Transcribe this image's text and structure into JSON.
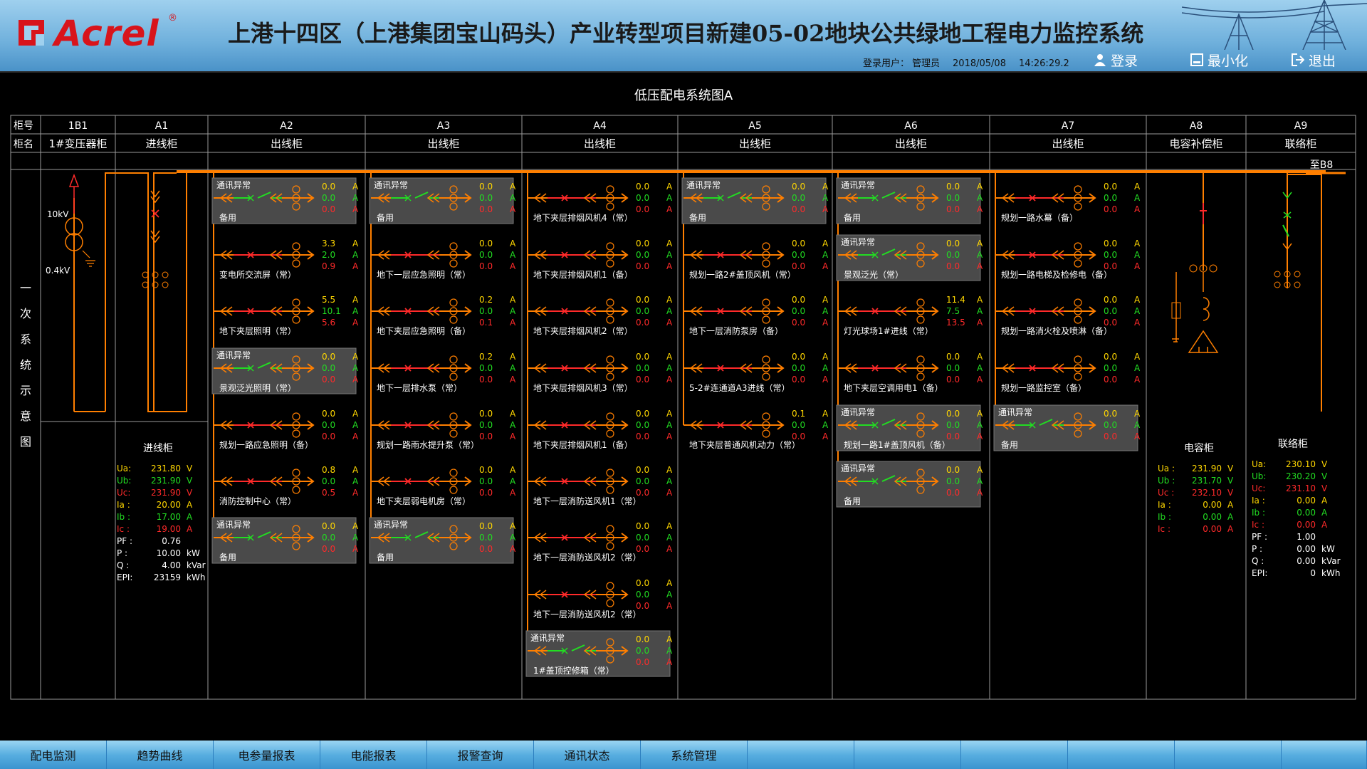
{
  "header": {
    "logo_text": "Acrel",
    "logo_reg": "®",
    "title": "上港十四区（上港集团宝山码头）产业转型项目新建05-02地块公共绿地工程电力监控系统",
    "user_label": "登录用户：",
    "user_name": "管理员",
    "date": "2018/05/08",
    "time": "14:26:29.2",
    "login_label": "登录",
    "minimize_label": "最小化",
    "exit_label": "退出"
  },
  "diagram_title": "低压配电系统图A",
  "row_labels": {
    "cabinet_no": "柜号",
    "cabinet_name": "柜名"
  },
  "side_label": [
    "一",
    "次",
    "系",
    "统",
    "示",
    "意",
    "图"
  ],
  "bus_to": "至B8",
  "cabinets": [
    {
      "no": "1B1",
      "name": "1#变压器柜"
    },
    {
      "no": "A1",
      "name": "进线柜"
    },
    {
      "no": "A2",
      "name": "出线柜"
    },
    {
      "no": "A3",
      "name": "出线柜"
    },
    {
      "no": "A4",
      "name": "出线柜"
    },
    {
      "no": "A5",
      "name": "出线柜"
    },
    {
      "no": "A6",
      "name": "出线柜"
    },
    {
      "no": "A7",
      "name": "出线柜"
    },
    {
      "no": "A8",
      "name": "电容补偿柜"
    },
    {
      "no": "A9",
      "name": "联络柜"
    }
  ],
  "transformer": {
    "hv": "10kV",
    "lv": "0.4kV"
  },
  "comm_error": "通讯异常",
  "unit_a": "A",
  "feeders": [
    [
      {
        "name": "备用",
        "err": true,
        "ia": "0.0",
        "ib": "0.0",
        "ic": "0.0"
      },
      {
        "name": "变电所交流屏（常）",
        "err": false,
        "ia": "3.3",
        "ib": "2.0",
        "ic": "0.9"
      },
      {
        "name": "地下夹层照明（常）",
        "err": false,
        "ia": "5.5",
        "ib": "10.1",
        "ic": "5.6"
      },
      {
        "name": "景观泛光照明（常）",
        "err": true,
        "ia": "0.0",
        "ib": "0.0",
        "ic": "0.0"
      },
      {
        "name": "规划一路应急照明（备）",
        "err": false,
        "ia": "0.0",
        "ib": "0.0",
        "ic": "0.0"
      },
      {
        "name": "消防控制中心（常）",
        "err": false,
        "ia": "0.8",
        "ib": "0.0",
        "ic": "0.5"
      },
      {
        "name": "备用",
        "err": true,
        "ia": "0.0",
        "ib": "0.0",
        "ic": "0.0"
      }
    ],
    [
      {
        "name": "备用",
        "err": true,
        "ia": "0.0",
        "ib": "0.0",
        "ic": "0.0"
      },
      {
        "name": "地下一层应急照明（常）",
        "err": false,
        "ia": "0.0",
        "ib": "0.0",
        "ic": "0.0"
      },
      {
        "name": "地下夹层应急照明（备）",
        "err": false,
        "ia": "0.2",
        "ib": "0.0",
        "ic": "0.1"
      },
      {
        "name": "地下一层排水泵（常）",
        "err": false,
        "ia": "0.2",
        "ib": "0.0",
        "ic": "0.0"
      },
      {
        "name": "规划一路雨水提升泵（常）",
        "err": false,
        "ia": "0.0",
        "ib": "0.0",
        "ic": "0.0"
      },
      {
        "name": "地下夹层弱电机房（常）",
        "err": false,
        "ia": "0.0",
        "ib": "0.0",
        "ic": "0.0"
      },
      {
        "name": "备用",
        "err": true,
        "ia": "0.0",
        "ib": "0.0",
        "ic": "0.0"
      }
    ],
    [
      {
        "name": "地下夹层排烟风机4（常）",
        "err": false,
        "ia": "0.0",
        "ib": "0.0",
        "ic": "0.0"
      },
      {
        "name": "地下夹层排烟风机1（备）",
        "err": false,
        "ia": "0.0",
        "ib": "0.0",
        "ic": "0.0"
      },
      {
        "name": "地下夹层排烟风机2（常）",
        "err": false,
        "ia": "0.0",
        "ib": "0.0",
        "ic": "0.0"
      },
      {
        "name": "地下夹层排烟风机3（常）",
        "err": false,
        "ia": "0.0",
        "ib": "0.0",
        "ic": "0.0"
      },
      {
        "name": "地下夹层排烟风机1（备）",
        "err": false,
        "ia": "0.0",
        "ib": "0.0",
        "ic": "0.0"
      },
      {
        "name": "地下一层消防送风机1（常）",
        "err": false,
        "ia": "0.0",
        "ib": "0.0",
        "ic": "0.0"
      },
      {
        "name": "地下一层消防送风机2（常）",
        "err": false,
        "ia": "0.0",
        "ib": "0.0",
        "ic": "0.0"
      },
      {
        "name": "地下一层消防送风机2（常）",
        "err": false,
        "ia": "0.0",
        "ib": "0.0",
        "ic": "0.0"
      },
      {
        "name": "1#盖顶控修箱（常）",
        "err": true,
        "ia": "0.0",
        "ib": "0.0",
        "ic": "0.0"
      }
    ],
    [
      {
        "name": "备用",
        "err": true,
        "ia": "0.0",
        "ib": "0.0",
        "ic": "0.0"
      },
      {
        "name": "规划一路2#盖顶风机（常）",
        "err": false,
        "ia": "0.0",
        "ib": "0.0",
        "ic": "0.0"
      },
      {
        "name": "地下一层消防泵房（备）",
        "err": false,
        "ia": "0.0",
        "ib": "0.0",
        "ic": "0.0"
      },
      {
        "name": "5-2#连通道A3进线（常）",
        "err": false,
        "ia": "0.0",
        "ib": "0.0",
        "ic": "0.0"
      },
      {
        "name": "地下夹层普通风机动力（常）",
        "err": false,
        "ia": "0.1",
        "ib": "0.0",
        "ic": "0.0"
      }
    ],
    [
      {
        "name": "备用",
        "err": true,
        "ia": "0.0",
        "ib": "0.0",
        "ic": "0.0"
      },
      {
        "name": "景观泛光（常）",
        "err": true,
        "ia": "0.0",
        "ib": "0.0",
        "ic": "0.0"
      },
      {
        "name": "灯光球场1#进线（常）",
        "err": false,
        "ia": "11.4",
        "ib": "7.5",
        "ic": "13.5"
      },
      {
        "name": "地下夹层空调用电1（备）",
        "err": false,
        "ia": "0.0",
        "ib": "0.0",
        "ic": "0.0"
      },
      {
        "name": "规划一路1#盖顶风机（备）",
        "err": true,
        "ia": "0.0",
        "ib": "0.0",
        "ic": "0.0"
      },
      {
        "name": "备用",
        "err": true,
        "ia": "0.0",
        "ib": "0.0",
        "ic": "0.0"
      }
    ],
    [
      {
        "name": "规划一路水幕（备）",
        "err": false,
        "ia": "0.0",
        "ib": "0.0",
        "ic": "0.0"
      },
      {
        "name": "规划一路电梯及检修电（备）",
        "err": false,
        "ia": "0.0",
        "ib": "0.0",
        "ic": "0.0"
      },
      {
        "name": "规划一路消火栓及喷淋（备）",
        "err": false,
        "ia": "0.0",
        "ib": "0.0",
        "ic": "0.0"
      },
      {
        "name": "规划一路监控室（备）",
        "err": false,
        "ia": "0.0",
        "ib": "0.0",
        "ic": "0.0"
      },
      {
        "name": "备用",
        "err": true,
        "ia": "0.0",
        "ib": "0.0",
        "ic": "0.0"
      }
    ]
  ],
  "meters": {
    "incoming": {
      "title": "进线柜",
      "rows": [
        {
          "k": "Ua:",
          "v": "231.80",
          "u": "V",
          "c": "#ffd700"
        },
        {
          "k": "Ub:",
          "v": "231.90",
          "u": "V",
          "c": "#22dd22"
        },
        {
          "k": "Uc:",
          "v": "231.90",
          "u": "V",
          "c": "#ff2a2a"
        },
        {
          "k": "Ia :",
          "v": "20.00",
          "u": "A",
          "c": "#ffd700"
        },
        {
          "k": "Ib :",
          "v": "17.00",
          "u": "A",
          "c": "#22dd22"
        },
        {
          "k": "Ic :",
          "v": "19.00",
          "u": "A",
          "c": "#ff2a2a"
        },
        {
          "k": "PF :",
          "v": "0.76",
          "u": "",
          "c": "#ffffff"
        },
        {
          "k": "P  :",
          "v": "10.00",
          "u": "kW",
          "c": "#ffffff"
        },
        {
          "k": "Q  :",
          "v": "4.00",
          "u": "kVar",
          "c": "#ffffff"
        },
        {
          "k": "EPI:",
          "v": "23159",
          "u": "kWh",
          "c": "#ffffff"
        }
      ]
    },
    "capacitor": {
      "title": "电容柜",
      "rows": [
        {
          "k": "Ua :",
          "v": "231.90",
          "u": "V",
          "c": "#ffd700"
        },
        {
          "k": "Ub :",
          "v": "231.70",
          "u": "V",
          "c": "#22dd22"
        },
        {
          "k": "Uc :",
          "v": "232.10",
          "u": "V",
          "c": "#ff2a2a"
        },
        {
          "k": "Ia :",
          "v": "0.00",
          "u": "A",
          "c": "#ffd700"
        },
        {
          "k": "Ib :",
          "v": "0.00",
          "u": "A",
          "c": "#22dd22"
        },
        {
          "k": "Ic :",
          "v": "0.00",
          "u": "A",
          "c": "#ff2a2a"
        }
      ]
    },
    "tie": {
      "title": "联络柜",
      "rows": [
        {
          "k": "Ua:",
          "v": "230.10",
          "u": "V",
          "c": "#ffd700"
        },
        {
          "k": "Ub:",
          "v": "230.20",
          "u": "V",
          "c": "#22dd22"
        },
        {
          "k": "Uc:",
          "v": "231.10",
          "u": "V",
          "c": "#ff2a2a"
        },
        {
          "k": "Ia :",
          "v": "0.00",
          "u": "A",
          "c": "#ffd700"
        },
        {
          "k": "Ib :",
          "v": "0.00",
          "u": "A",
          "c": "#22dd22"
        },
        {
          "k": "Ic :",
          "v": "0.00",
          "u": "A",
          "c": "#ff2a2a"
        },
        {
          "k": "PF :",
          "v": "1.00",
          "u": "",
          "c": "#ffffff"
        },
        {
          "k": "P  :",
          "v": "0.00",
          "u": "kW",
          "c": "#ffffff"
        },
        {
          "k": "Q  :",
          "v": "0.00",
          "u": "kVar",
          "c": "#ffffff"
        },
        {
          "k": "EPI:",
          "v": "0",
          "u": "kWh",
          "c": "#ffffff"
        }
      ]
    }
  },
  "colors": {
    "bus": "#ff7f00",
    "breaker_closed": "#22dd22",
    "breaker_open": "#ff2a2a",
    "ia": "#ffd700",
    "ib": "#22dd22",
    "ic": "#ff2a2a",
    "err_box": "#4a4a4a"
  },
  "nav": [
    "配电监测",
    "趋势曲线",
    "电参量报表",
    "电能报表",
    "报警查询",
    "通讯状态",
    "系统管理",
    "",
    "",
    "",
    "",
    "",
    ""
  ]
}
